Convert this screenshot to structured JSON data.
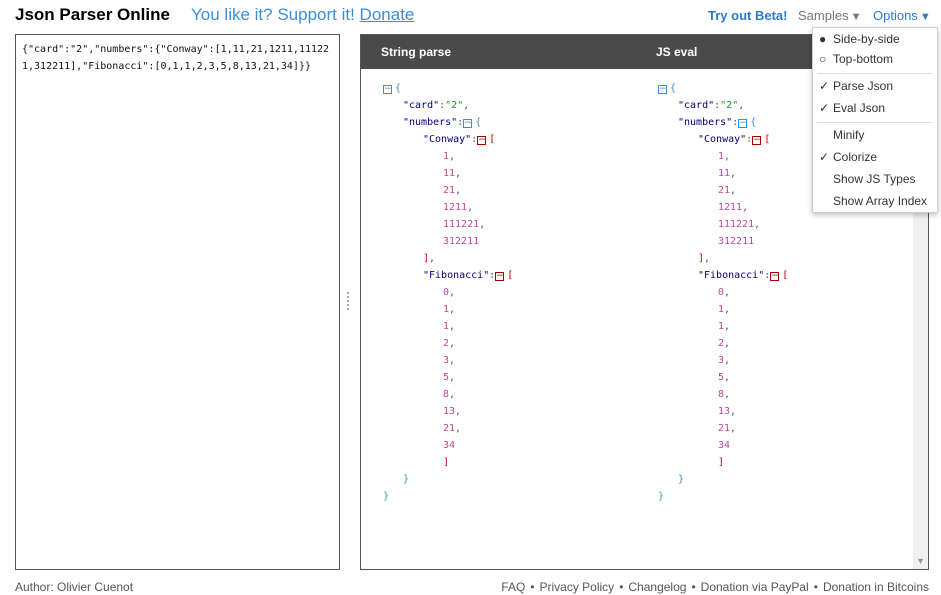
{
  "header": {
    "title": "Json Parser Online",
    "support_text": "You like it? Support it!",
    "donate_label": "Donate",
    "beta_label": "Try out Beta!",
    "samples_label": "Samples",
    "options_label": "Options"
  },
  "input": {
    "text": "{\"card\":\"2\",\"numbers\":{\"Conway\":[1,11,21,1211,111221,312211],\"Fibonacci\":[0,1,1,2,3,5,8,13,21,34]}}"
  },
  "output": {
    "left_header": "String parse",
    "right_header": "JS eval",
    "json": {
      "card_key": "\"card\"",
      "card_value": "\"2\"",
      "numbers_key": "\"numbers\"",
      "conway_key": "\"Conway\"",
      "conway": [
        "1",
        "11",
        "21",
        "1211",
        "111221",
        "312211"
      ],
      "fibonacci_key": "\"Fibonacci\"",
      "fibonacci": [
        "0",
        "1",
        "1",
        "2",
        "3",
        "5",
        "8",
        "13",
        "21",
        "34"
      ]
    }
  },
  "options_menu": {
    "items": [
      {
        "mark": "●",
        "label": "Side-by-side"
      },
      {
        "mark": "○",
        "label": "Top-bottom"
      },
      {
        "mark": "✓",
        "label": "Parse Json"
      },
      {
        "mark": "✓",
        "label": "Eval Json"
      },
      {
        "mark": "",
        "label": "Minify"
      },
      {
        "mark": "✓",
        "label": "Colorize"
      },
      {
        "mark": "",
        "label": "Show JS Types"
      },
      {
        "mark": "",
        "label": "Show Array Index"
      }
    ]
  },
  "footer": {
    "author": "Author: Olivier Cuenot",
    "links": [
      "FAQ",
      "Privacy Policy",
      "Changelog",
      "Donation via PayPal",
      "Donation in Bitcoins"
    ]
  },
  "colors": {
    "accent": "#3a8fd8",
    "header_bar": "#4a4a4a",
    "key": "#00007a",
    "string": "#1a9b1a",
    "number": "#c24696"
  }
}
